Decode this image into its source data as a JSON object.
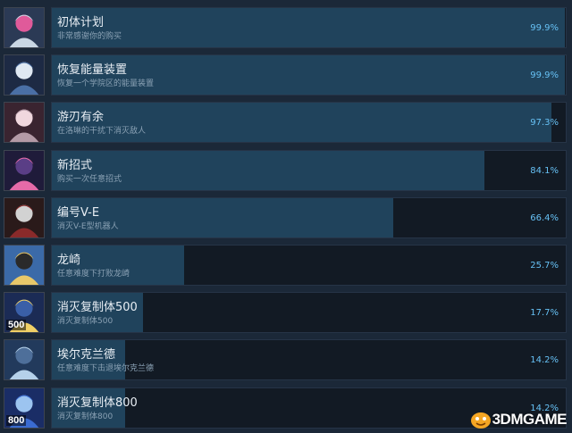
{
  "colors": {
    "background": "#1b2838",
    "track": "#121a24",
    "fill": "#20435c",
    "percent_text": "#66c0f4"
  },
  "achievements": [
    {
      "icon": "achievement-icon-first-plan",
      "title": "初体计划",
      "desc": "非常感谢你的购买",
      "percent": "99.9%",
      "fraction": 0.999
    },
    {
      "icon": "achievement-icon-energy-device",
      "title": "恢复能量装置",
      "desc": "恢复一个学院区的能量装置",
      "percent": "99.9%",
      "fraction": 0.999
    },
    {
      "icon": "achievement-icon-blade",
      "title": "游刃有余",
      "desc": "在洛琳的干扰下消灭敌人",
      "percent": "97.3%",
      "fraction": 0.973
    },
    {
      "icon": "achievement-icon-new-move",
      "title": "新招式",
      "desc": "购买一次任意招式",
      "percent": "84.1%",
      "fraction": 0.841
    },
    {
      "icon": "achievement-icon-robot",
      "title": "编号V-E",
      "desc": "消灭V-E型机器人",
      "percent": "66.4%",
      "fraction": 0.664
    },
    {
      "icon": "achievement-icon-longqi",
      "title": "龙崎",
      "desc": "任意难度下打败龙崎",
      "percent": "25.7%",
      "fraction": 0.257
    },
    {
      "icon": "achievement-icon-clone-500",
      "title": "消灭复制体500",
      "desc": "消灭复制体500",
      "percent": "17.7%",
      "fraction": 0.177,
      "badge": "500"
    },
    {
      "icon": "achievement-icon-erkelande",
      "title": "埃尔克兰德",
      "desc": "任意难度下击退埃尔克兰德",
      "percent": "14.2%",
      "fraction": 0.142
    },
    {
      "icon": "achievement-icon-clone-800",
      "title": "消灭复制体800",
      "desc": "消灭复制体800",
      "percent": "14.2%",
      "fraction": 0.142,
      "badge": "800"
    }
  ],
  "watermark": {
    "text": "3DMGAME"
  }
}
